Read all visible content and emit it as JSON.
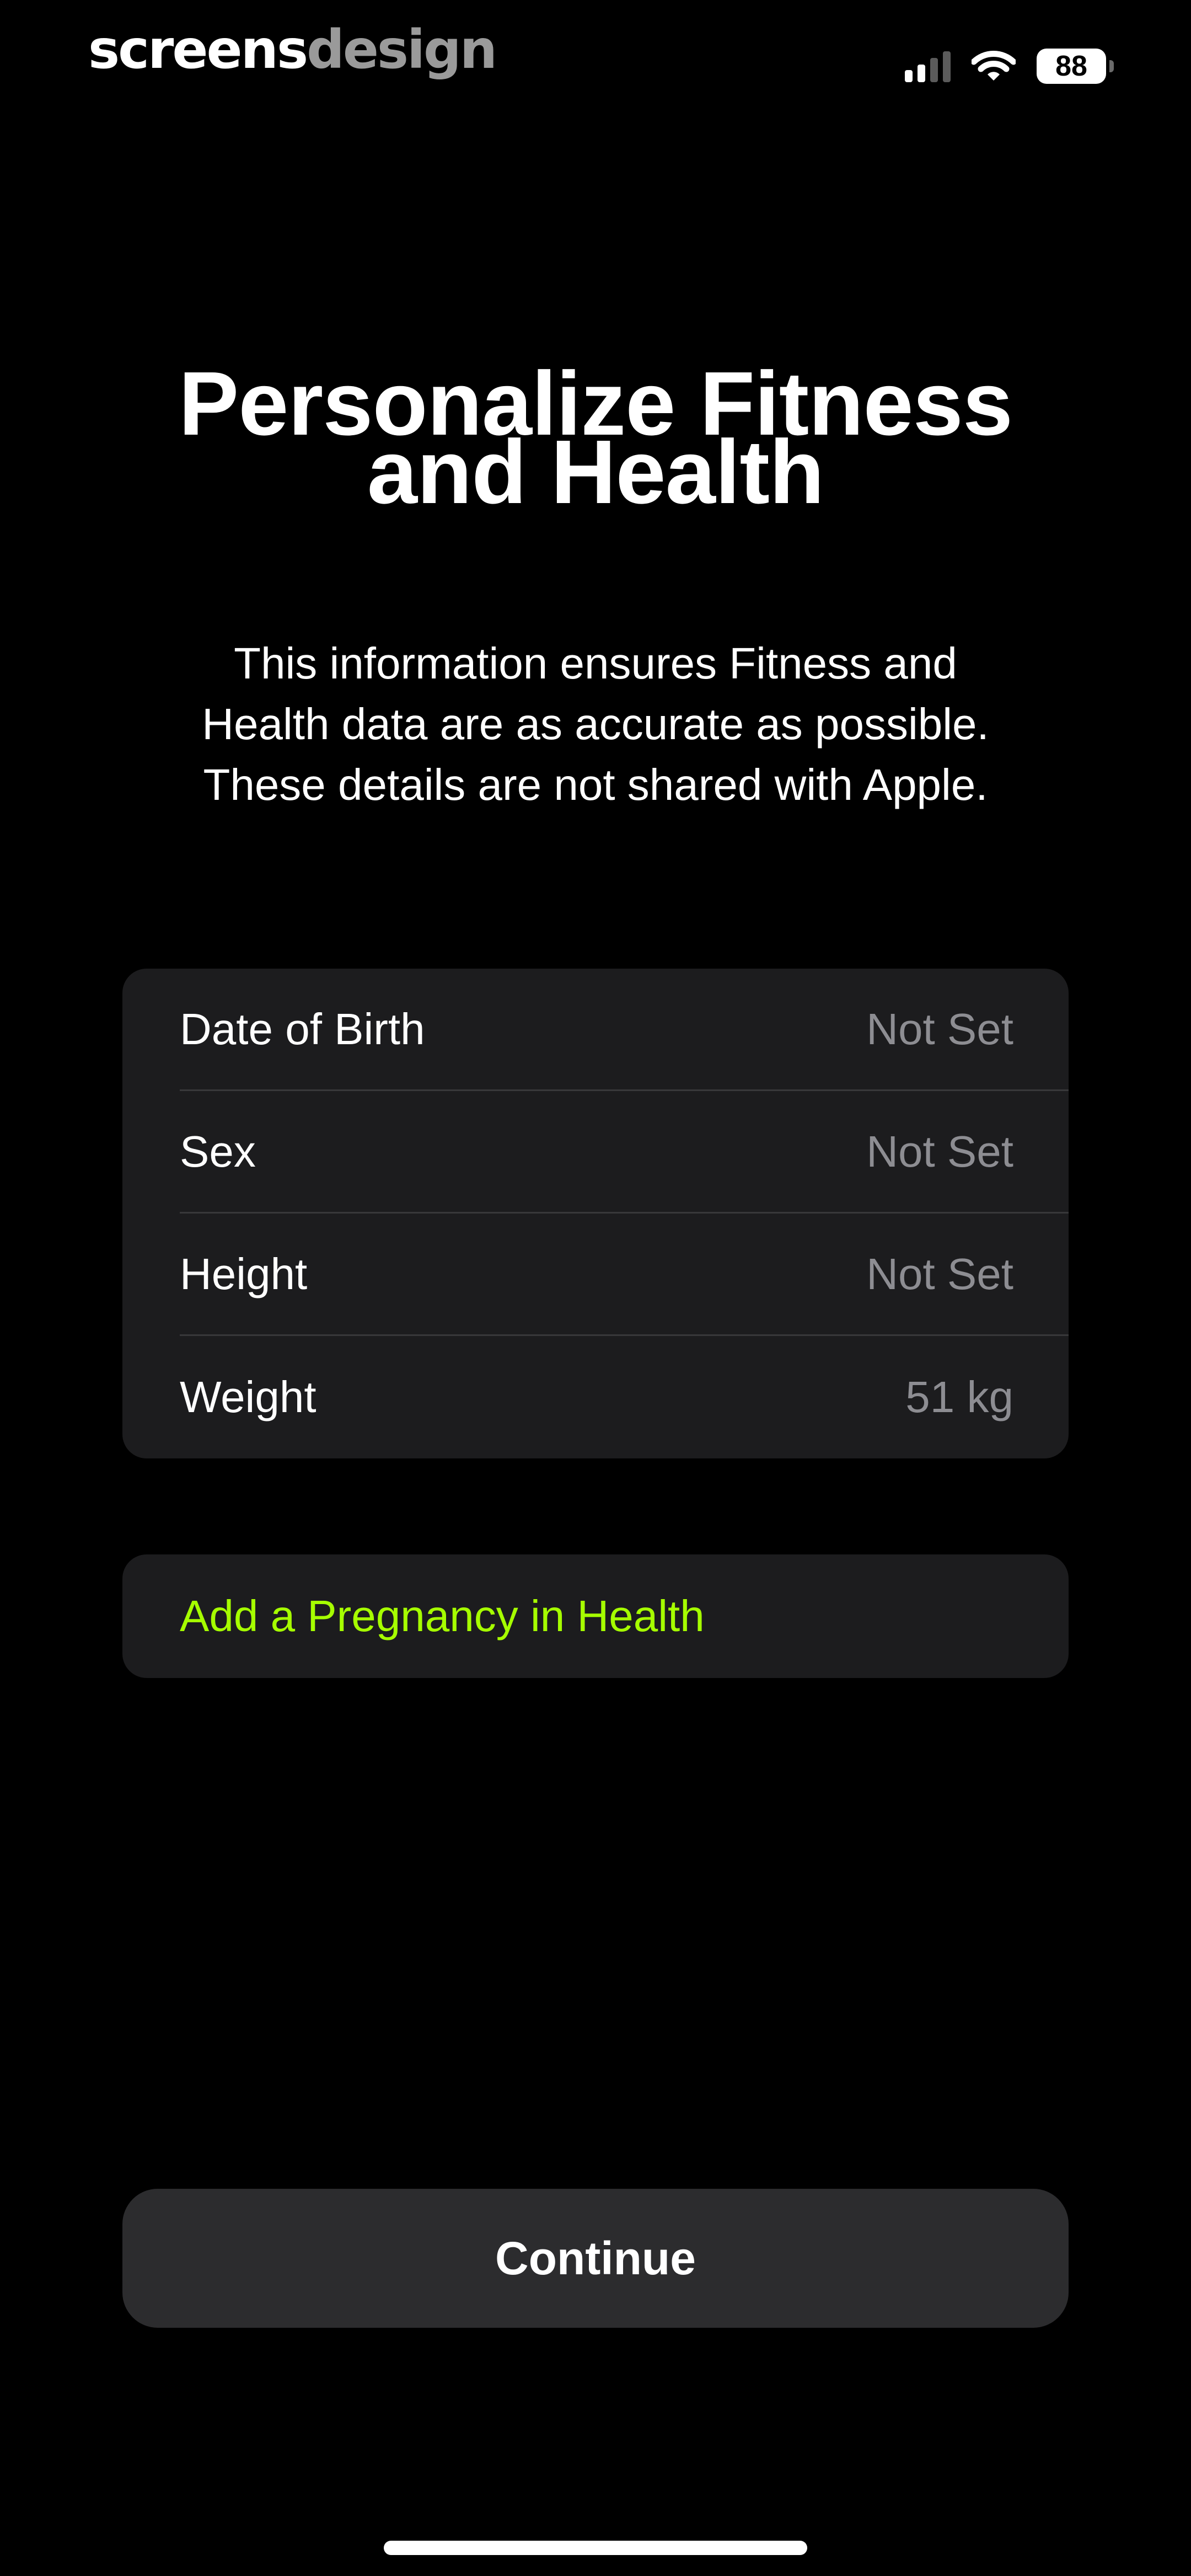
{
  "watermark": {
    "part1": "screens",
    "part2": "design"
  },
  "status_bar": {
    "battery_level": "88",
    "signal_bars_filled": 2,
    "signal_bars_total": 4,
    "icons": [
      "signal-icon",
      "wifi-icon",
      "battery-icon"
    ]
  },
  "header": {
    "title_line1": "Personalize Fitness",
    "title_line2": "and Health",
    "subtitle_line1": "This information ensures Fitness and",
    "subtitle_line2": "Health data are as accurate as possible.",
    "subtitle_line3": "These details are not shared with Apple."
  },
  "details": {
    "rows": [
      {
        "label": "Date of Birth",
        "value": "Not Set"
      },
      {
        "label": "Sex",
        "value": "Not Set"
      },
      {
        "label": "Height",
        "value": "Not Set"
      },
      {
        "label": "Weight",
        "value": "51 kg"
      }
    ]
  },
  "pregnancy": {
    "label": "Add a Pregnancy in Health"
  },
  "actions": {
    "continue_label": "Continue"
  },
  "colors": {
    "background": "#000000",
    "card": "#1c1c1e",
    "button": "#2c2c2e",
    "accent": "#a6ff00",
    "secondary_text": "#8d8d92"
  }
}
